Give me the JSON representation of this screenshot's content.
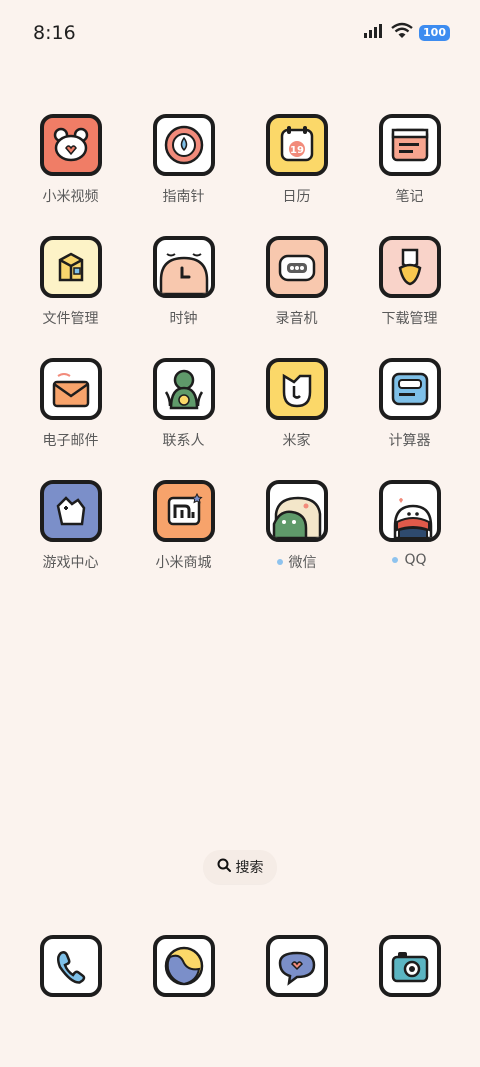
{
  "status_bar": {
    "time": "8:16",
    "battery": "100"
  },
  "apps": [
    {
      "label": "小米视频",
      "icon": "video-bear-icon",
      "badge": false
    },
    {
      "label": "指南针",
      "icon": "compass-icon",
      "badge": false
    },
    {
      "label": "日历",
      "icon": "calendar-icon",
      "badge": false,
      "date": "19"
    },
    {
      "label": "笔记",
      "icon": "notes-icon",
      "badge": false
    },
    {
      "label": "文件管理",
      "icon": "folder-box-icon",
      "badge": false
    },
    {
      "label": "时钟",
      "icon": "clock-icon",
      "badge": false
    },
    {
      "label": "录音机",
      "icon": "recorder-icon",
      "badge": false
    },
    {
      "label": "下载管理",
      "icon": "download-icon",
      "badge": false
    },
    {
      "label": "电子邮件",
      "icon": "envelope-icon",
      "badge": false
    },
    {
      "label": "联系人",
      "icon": "contacts-icon",
      "badge": false
    },
    {
      "label": "米家",
      "icon": "mijia-icon",
      "badge": false
    },
    {
      "label": "计算器",
      "icon": "calculator-icon",
      "badge": false
    },
    {
      "label": "游戏中心",
      "icon": "game-center-icon",
      "badge": false
    },
    {
      "label": "小米商城",
      "icon": "mi-store-icon",
      "badge": false
    },
    {
      "label": "微信",
      "icon": "wechat-icon",
      "badge": true
    },
    {
      "label": "QQ",
      "icon": "qq-icon",
      "badge": true
    }
  ],
  "search": {
    "label": "搜索"
  },
  "dock": [
    {
      "icon": "phone-icon"
    },
    {
      "icon": "browser-globe-icon"
    },
    {
      "icon": "messages-icon"
    },
    {
      "icon": "camera-icon"
    }
  ],
  "colors": {
    "background": "#fbf3ee",
    "badge_dot": "#8ec3ee",
    "battery": "#3d8cf0"
  }
}
